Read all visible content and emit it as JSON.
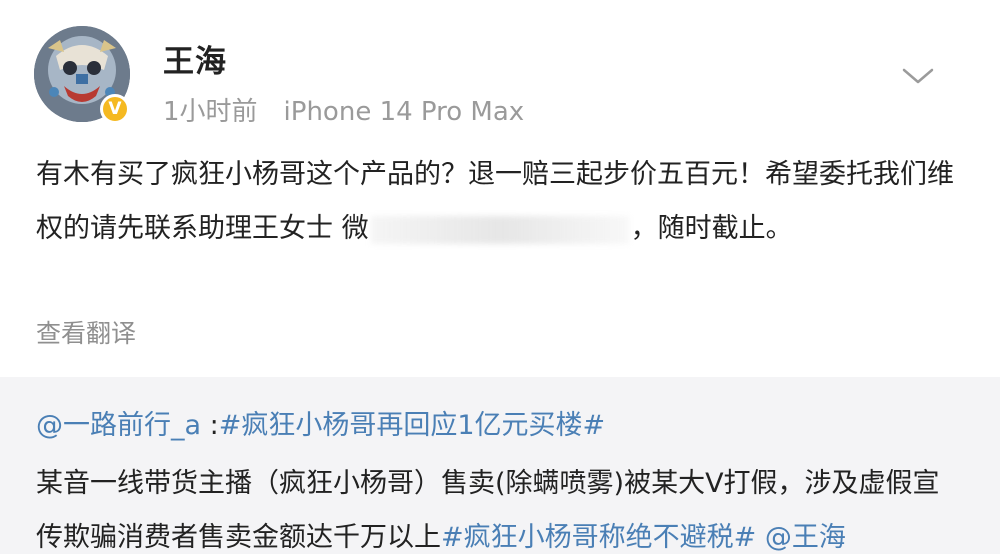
{
  "header": {
    "username": "王海",
    "timestamp": "1小时前",
    "device": "iPhone 14 Pro Max",
    "verified_badge": "V"
  },
  "post": {
    "text_part1": "有木有买了疯狂小杨哥这个产品的？退一赔三起步价五百元！希望委托我们维权的请先联系助理王女士 微",
    "text_part2": "，随时截止。",
    "translate_label": "查看翻译"
  },
  "retweet": {
    "mention_user": "@一路前行_a",
    "separator": " :",
    "hashtag1": "#疯狂小杨哥再回应1亿元买楼#",
    "body_text": "某音一线带货主播（疯狂小杨哥）售卖(除螨喷雾)被某大V打假，涉及虚假宣传欺骗消费者售卖金额达千万以上",
    "hashtag2": "#疯狂小杨哥称绝不避税#",
    "mention_end": " @王海"
  },
  "colors": {
    "link": "#4a7fb5",
    "badge": "#f5b921",
    "retweet_bg": "#f4f4f6"
  },
  "icons": [
    "avatar-image",
    "verified-badge-icon",
    "chevron-down-icon"
  ]
}
